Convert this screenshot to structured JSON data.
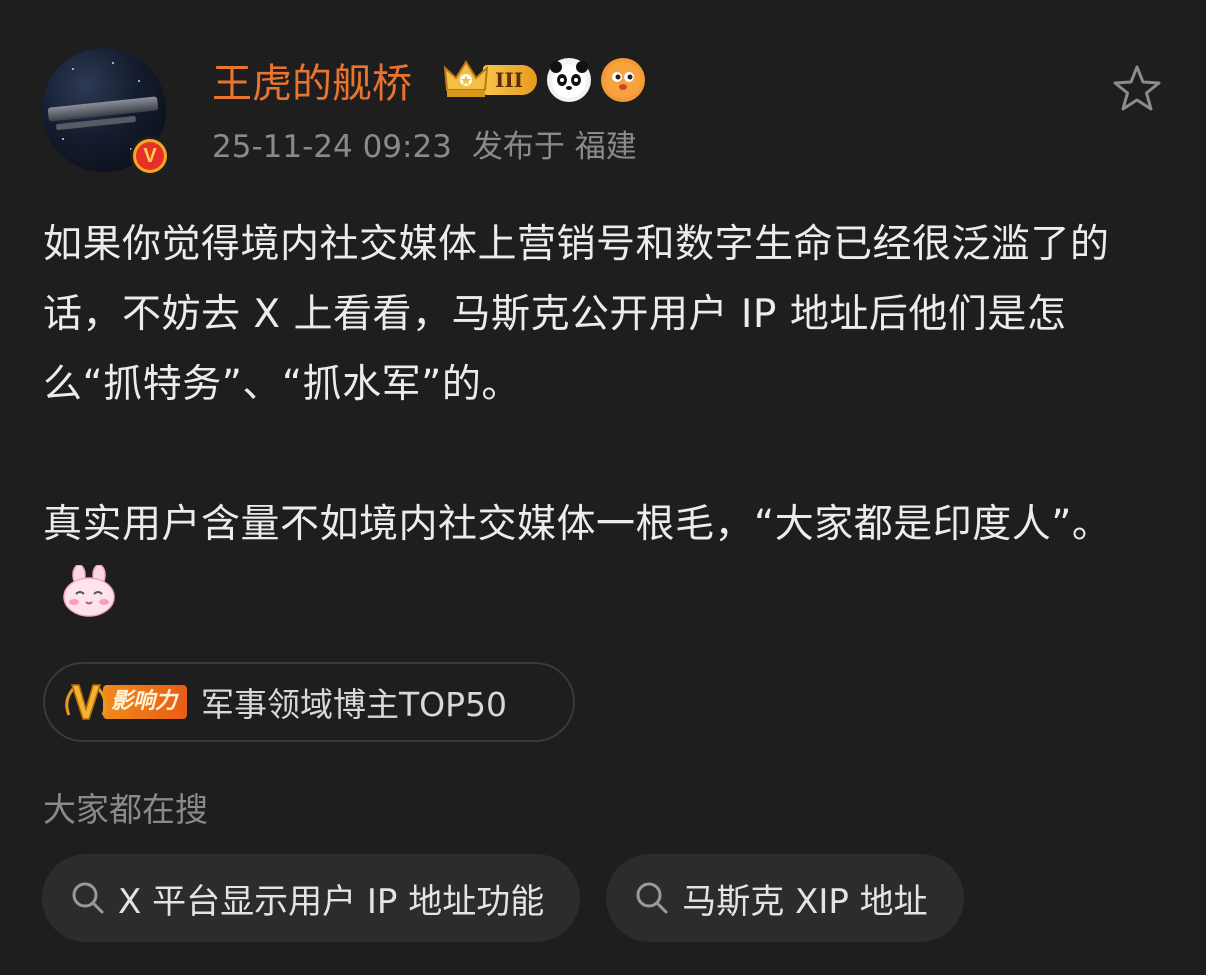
{
  "post": {
    "author": {
      "name": "王虎的舰桥",
      "verified_mark": "V",
      "rank_badge": "III"
    },
    "meta": {
      "time": "25-11-24 09:23",
      "location": "发布于 福建"
    },
    "paragraphs": [
      "如果你觉得境内社交媒体上营销号和数字生命已经很泛滥了的话，不妨去 X 上看看，马斯克公开用户 IP 地址后他们是怎么“抓特务”、“抓水军”的。",
      "真实用户含量不如境内社交媒体一根毛，“大家都是印度人”。"
    ],
    "influence": {
      "badge_text": "影响力",
      "label": "军事领域博主TOP50"
    }
  },
  "search_section": {
    "title": "大家都在搜",
    "chips": [
      {
        "label": "X 平台显示用户 IP 地址功能"
      },
      {
        "label": "马斯克 XIP 地址"
      }
    ]
  },
  "colors": {
    "background": "#1e1e1e",
    "username": "#e8742f",
    "meta_text": "#8a8a8a",
    "body_text": "#ececec",
    "chip_bg": "#2c2c2c"
  },
  "icons": {
    "favorite": "star-outline-icon",
    "search": "search-icon",
    "emoji": "pink-bunny-emoji"
  }
}
